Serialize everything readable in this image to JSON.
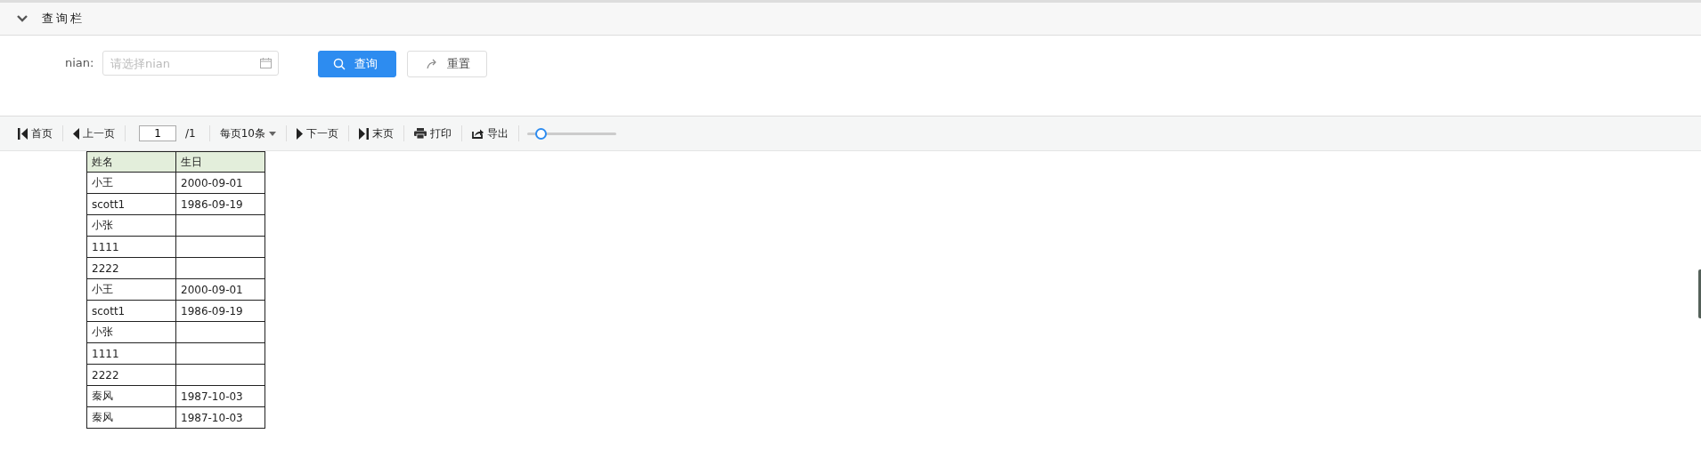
{
  "query_panel": {
    "title": "查询栏",
    "expanded": true
  },
  "form": {
    "label": "nian:",
    "placeholder": "请选择nian",
    "buttons": [
      {
        "kind": "search",
        "label": "查询"
      },
      {
        "kind": "reset",
        "label": "重置"
      }
    ]
  },
  "toolbar": {
    "first": "首页",
    "prev": "上一页",
    "page": "1",
    "total": "/1",
    "page_size": "每页10条",
    "next": "下一页",
    "last": "末页",
    "print": "打印",
    "export": "导出",
    "zoom": {
      "level": 0.15
    }
  },
  "table": {
    "columns": [
      "姓名",
      "生日"
    ],
    "rows": [
      [
        "小王",
        "2000-09-01"
      ],
      [
        "scott1",
        "1986-09-19"
      ],
      [
        "小张",
        ""
      ],
      [
        "1111",
        ""
      ],
      [
        "2222",
        ""
      ],
      [
        "小王",
        "2000-09-01"
      ],
      [
        "scott1",
        "1986-09-19"
      ],
      [
        "小张",
        ""
      ],
      [
        "1111",
        ""
      ],
      [
        "2222",
        ""
      ],
      [
        "秦风",
        "1987-10-03"
      ],
      [
        "秦风",
        "1987-10-03"
      ]
    ]
  }
}
